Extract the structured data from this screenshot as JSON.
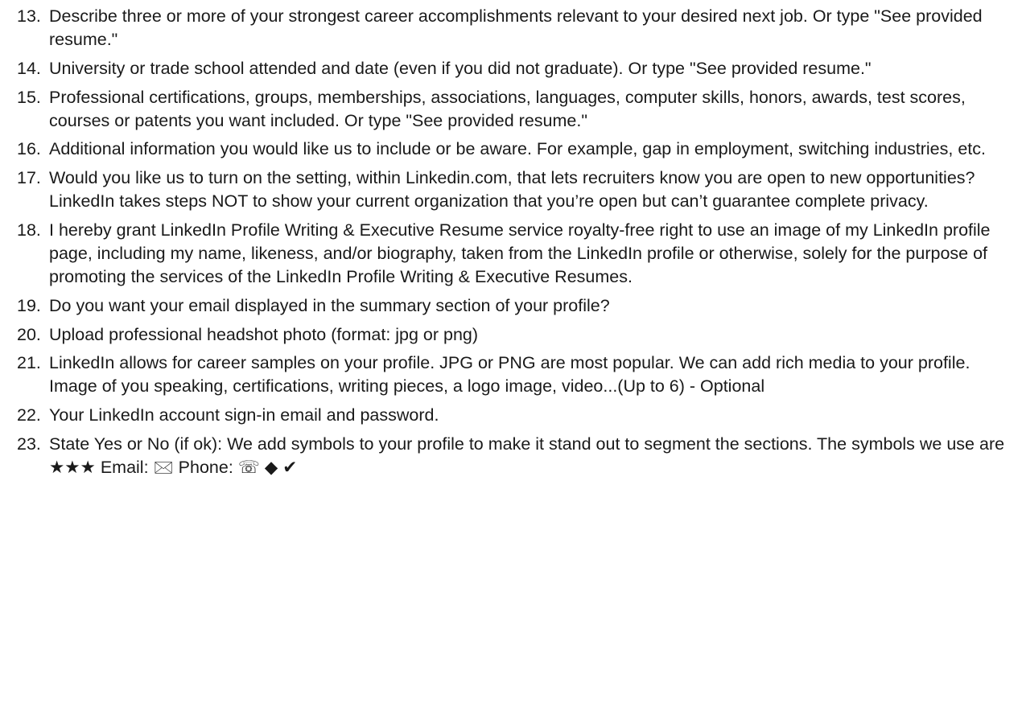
{
  "questions": [
    {
      "number": "13.",
      "text": "Describe three or more of your strongest career accomplishments relevant to your desired next job. Or type \"See provided resume.\""
    },
    {
      "number": "14.",
      "text": "University or trade school attended and date (even if you did not graduate). Or type \"See provided resume.\""
    },
    {
      "number": "15.",
      "text": "Professional certifications, groups, memberships, associations, languages, computer skills, honors, awards, test scores, courses or patents you want included. Or type \"See provided resume.\""
    },
    {
      "number": "16.",
      "text": "Additional information you would like us to include or be aware. For example, gap in employment, switching industries, etc."
    },
    {
      "number": "17.",
      "text": "Would you like us to turn on the setting, within Linkedin.com, that lets recruiters know you are open to new opportunities? LinkedIn takes steps NOT to show your current organization that you’re open but can’t guarantee complete privacy."
    },
    {
      "number": "18.",
      "text": "I hereby grant LinkedIn Profile Writing & Executive Resume service royalty-free right to use an image of my LinkedIn profile page, including my name, likeness, and/or biography, taken from the LinkedIn profile or otherwise, solely for the purpose of promoting the services of the LinkedIn Profile Writing & Executive Resumes."
    },
    {
      "number": "19.",
      "text": "Do you want your email displayed in the summary section of your profile?"
    },
    {
      "number": "20.",
      "text": "Upload professional headshot photo (format: jpg or png)"
    },
    {
      "number": "21.",
      "text": "LinkedIn allows for career samples on your profile. JPG or PNG are most popular. We can add rich media to your profile. Image of you speaking, certifications, writing pieces, a logo image, video...(Up to 6) - Optional"
    },
    {
      "number": "22.",
      "text": "Your LinkedIn account sign-in email and password."
    }
  ],
  "last_question": {
    "number": "23.",
    "text": "State Yes or No (if ok): We add symbols to your profile to make it stand out to segment the sections. The symbols we use are",
    "stars": "★★★",
    "email_label": "Email:",
    "email_symbol": "🖂",
    "phone_label": "Phone:",
    "phone_symbol": "☏",
    "diamond_symbol": "◆",
    "check_symbol": "✔"
  }
}
